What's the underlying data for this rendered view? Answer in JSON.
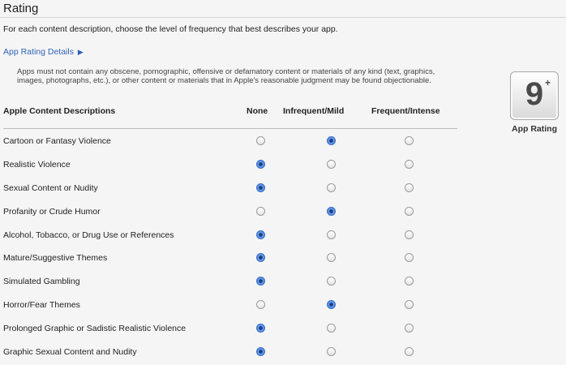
{
  "page": {
    "title": "Rating",
    "instructions": "For each content description, choose the level of frequency that best describes your app.",
    "details_link": "App Rating Details",
    "disclaimer": "Apps must not contain any obscene, pornographic, offensive or defamatory content or materials of any kind (text, graphics, images, photographs, etc.), or other content or materials that in Apple's reasonable judgment may be found objectionable."
  },
  "table": {
    "headers": {
      "description": "Apple Content Descriptions",
      "none": "None",
      "mild": "Infrequent/Mild",
      "intense": "Frequent/Intense"
    },
    "rows": [
      {
        "label": "Cartoon or Fantasy Violence",
        "selected": "mild"
      },
      {
        "label": "Realistic Violence",
        "selected": "none"
      },
      {
        "label": "Sexual Content or Nudity",
        "selected": "none"
      },
      {
        "label": "Profanity or Crude Humor",
        "selected": "mild"
      },
      {
        "label": "Alcohol, Tobacco, or Drug Use or References",
        "selected": "none"
      },
      {
        "label": "Mature/Suggestive Themes",
        "selected": "none"
      },
      {
        "label": "Simulated Gambling",
        "selected": "none"
      },
      {
        "label": "Horror/Fear Themes",
        "selected": "mild"
      },
      {
        "label": "Prolonged Graphic or Sadistic Realistic Violence",
        "selected": "none"
      },
      {
        "label": "Graphic Sexual Content and Nudity",
        "selected": "none"
      }
    ]
  },
  "badge": {
    "rating": "9",
    "plus": "+",
    "label": "App Rating"
  },
  "colors": {
    "link": "#2f63b6",
    "radio_selected": "#3f78d6"
  },
  "icons": {
    "link_arrow": "triangle-right-icon"
  }
}
